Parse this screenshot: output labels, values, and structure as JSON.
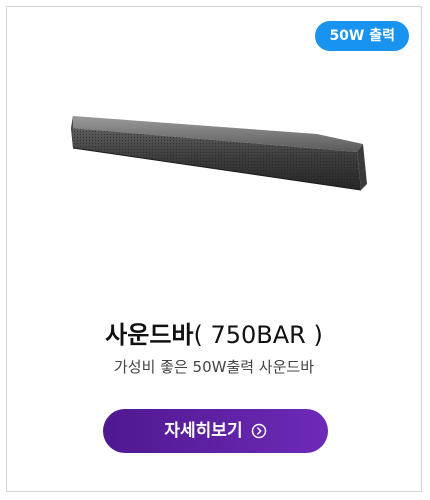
{
  "badge": {
    "label": "50W 출력",
    "color": "#1993f0"
  },
  "product": {
    "image_icon": "soundbar-image",
    "name": "사운드바",
    "model": "( 750BAR )",
    "description": "가성비 좋은 50W출력 사운드바"
  },
  "cta": {
    "label": "자세히보기",
    "icon": "chevron-right-circle-icon",
    "gradient_start": "#4f1890",
    "gradient_end": "#6d2ab8"
  }
}
